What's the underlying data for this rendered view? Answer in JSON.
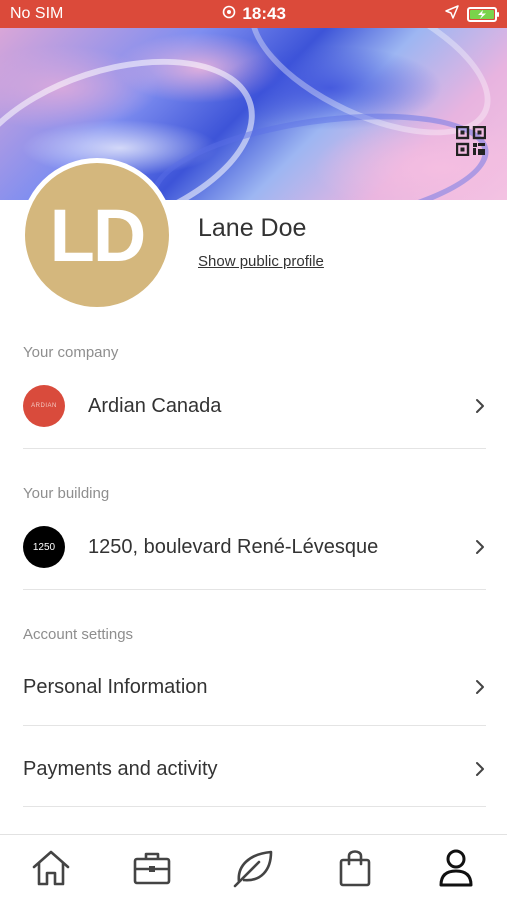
{
  "status_bar": {
    "carrier": "No SIM",
    "time": "18:43",
    "bg_color": "#db4a3a",
    "icons": [
      "alarm-icon",
      "location-arrow-icon",
      "battery-charging-icon"
    ]
  },
  "cover": {
    "qr_icon": "qr-code-icon"
  },
  "profile": {
    "initials": "LD",
    "avatar_color": "#d4b77d",
    "name": "Lane Doe",
    "public_profile_link": "Show public profile"
  },
  "company": {
    "section_label": "Your company",
    "name": "Ardian Canada",
    "logo_text": "ARDIAN",
    "logo_color": "#d94b3c"
  },
  "building": {
    "section_label": "Your building",
    "address": "1250, boulevard René-Lévesque",
    "logo_text": "1250",
    "logo_color": "#000000"
  },
  "account": {
    "section_label": "Account settings",
    "items": [
      {
        "label": "Personal Information"
      },
      {
        "label": "Payments and activity"
      }
    ]
  },
  "tab_bar": {
    "tabs": [
      {
        "name": "home",
        "icon": "home-icon",
        "active": false
      },
      {
        "name": "work",
        "icon": "briefcase-icon",
        "active": false
      },
      {
        "name": "wellness",
        "icon": "leaf-icon",
        "active": false
      },
      {
        "name": "shop",
        "icon": "shopping-bag-icon",
        "active": false
      },
      {
        "name": "profile",
        "icon": "user-icon",
        "active": true
      }
    ]
  }
}
